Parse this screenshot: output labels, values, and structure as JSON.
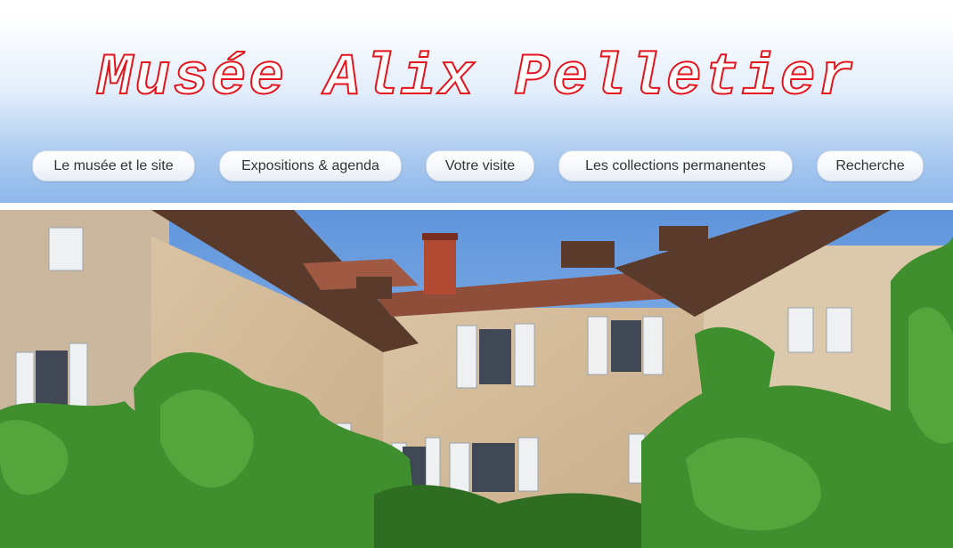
{
  "header": {
    "site_title": "Musée Alix Pelletier"
  },
  "nav": {
    "items": [
      {
        "label": "Le musée et le site"
      },
      {
        "label": "Expositions & agenda"
      },
      {
        "label": "Votre visite"
      },
      {
        "label": "Les collections permanentes"
      },
      {
        "label": "Recherche"
      }
    ]
  },
  "colors": {
    "title_stroke": "#e4141c",
    "header_gradient_bottom": "#8fb8ec",
    "nav_text": "#333333"
  }
}
